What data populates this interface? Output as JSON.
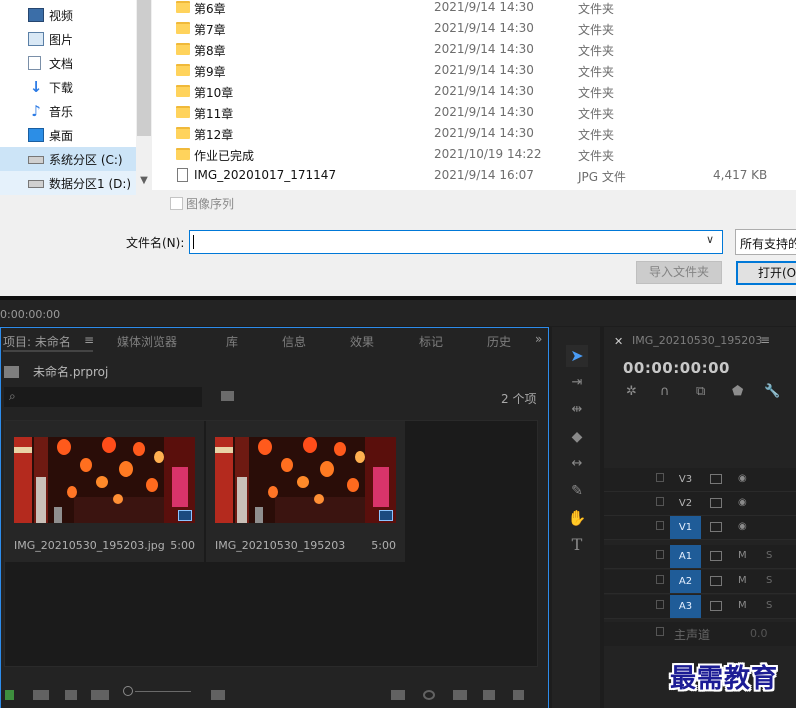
{
  "dialog": {
    "nav_items": [
      {
        "label": "视频",
        "icon": "video-icon"
      },
      {
        "label": "图片",
        "icon": "picture-icon"
      },
      {
        "label": "文档",
        "icon": "document-icon"
      },
      {
        "label": "下载",
        "icon": "download-icon"
      },
      {
        "label": "音乐",
        "icon": "music-icon"
      },
      {
        "label": "桌面",
        "icon": "desktop-icon"
      },
      {
        "label": "系统分区 (C:)",
        "icon": "drive-icon"
      },
      {
        "label": "数据分区1 (D:)",
        "icon": "drive-icon"
      }
    ],
    "files": [
      {
        "name": "第6章",
        "date": "2021/9/14 14:30",
        "type": "文件夹",
        "size": ""
      },
      {
        "name": "第7章",
        "date": "2021/9/14 14:30",
        "type": "文件夹",
        "size": ""
      },
      {
        "name": "第8章",
        "date": "2021/9/14 14:30",
        "type": "文件夹",
        "size": ""
      },
      {
        "name": "第9章",
        "date": "2021/9/14 14:30",
        "type": "文件夹",
        "size": ""
      },
      {
        "name": "第10章",
        "date": "2021/9/14 14:30",
        "type": "文件夹",
        "size": ""
      },
      {
        "name": "第11章",
        "date": "2021/9/14 14:30",
        "type": "文件夹",
        "size": ""
      },
      {
        "name": "第12章",
        "date": "2021/9/14 14:30",
        "type": "文件夹",
        "size": ""
      },
      {
        "name": "作业已完成",
        "date": "2021/10/19 14:22",
        "type": "文件夹",
        "size": ""
      },
      {
        "name": "IMG_20201017_171147",
        "date": "2021/9/14 16:07",
        "type": "JPG 文件",
        "size": "4,417 KB"
      }
    ],
    "image_sequence_label": "图像序列",
    "filename_label": "文件名(N):",
    "filename_value": "",
    "filter_label": "所有支持的",
    "import_folder_label": "导入文件夹",
    "open_label": "打开(O"
  },
  "premiere": {
    "timecode": "0:00:00:00",
    "tabs": [
      "项目: 未命名",
      "媒体浏览器",
      "库",
      "信息",
      "效果",
      "标记",
      "历史"
    ],
    "project_file": "未命名.prproj",
    "item_count": "2 个项",
    "clips": [
      {
        "name": "IMG_20210530_195203.jpg",
        "duration": "5:00"
      },
      {
        "name": "IMG_20210530_195203",
        "duration": "5:00"
      }
    ],
    "timeline": {
      "title": "IMG_20210530_195203",
      "timecode": "00:00:00:00",
      "video_tracks": [
        "V3",
        "V2",
        "V1"
      ],
      "audio_tracks": [
        "A1",
        "A2",
        "A3"
      ],
      "mute_label": "M",
      "solo_label": "S",
      "master_label": "主声道",
      "master_value": "0.0"
    }
  },
  "watermark": "最需教育",
  "colors": {
    "accent": "#0078d7",
    "premiere_blue": "#2d8ceb",
    "track_on": "#1f5c98",
    "folder": "#ffd35c"
  }
}
